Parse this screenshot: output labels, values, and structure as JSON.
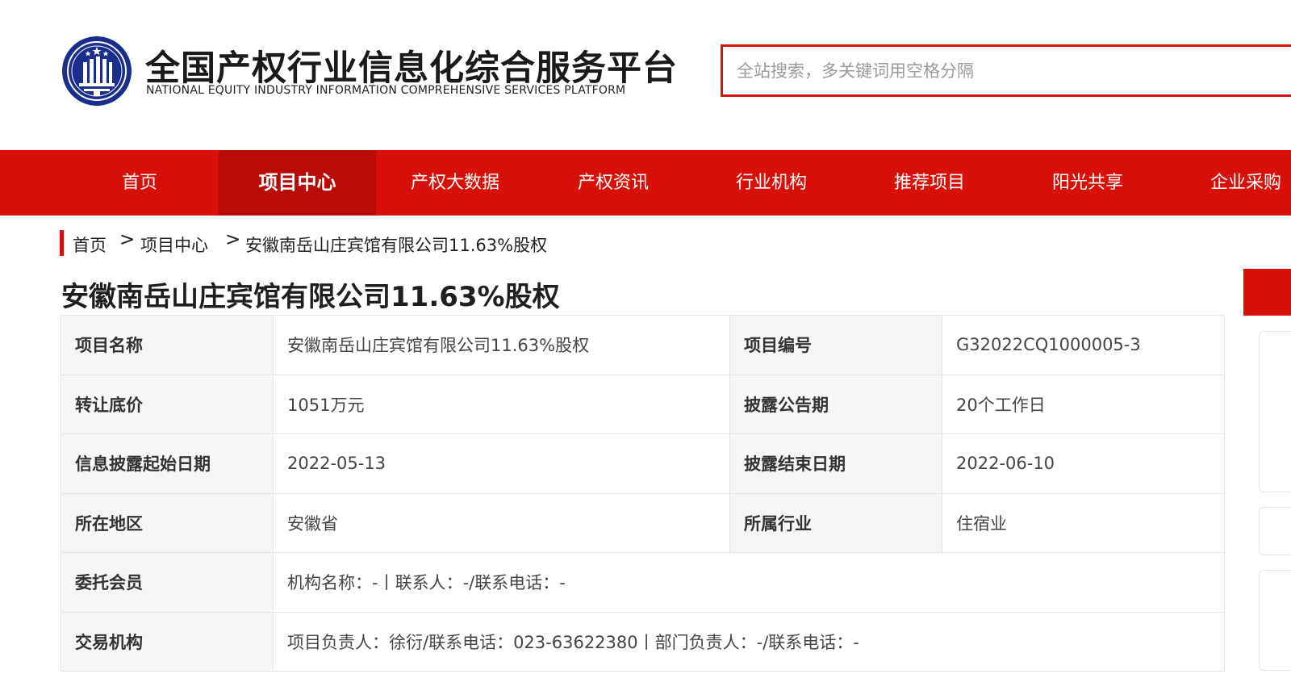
{
  "header": {
    "title_cn": "全国产权行业信息化综合服务平台",
    "title_en": "NATIONAL EQUITY INDUSTRY INFORMATION COMPREHENSIVE SERVICES PLATFORM",
    "logo_icon": "national-emblem-logo-icon",
    "search_placeholder": "全站搜索，多关键词用空格分隔"
  },
  "nav": {
    "items": [
      {
        "label": "首页"
      },
      {
        "label": "项目中心",
        "active": true
      },
      {
        "label": "产权大数据"
      },
      {
        "label": "产权资讯"
      },
      {
        "label": "行业机构"
      },
      {
        "label": "推荐项目"
      },
      {
        "label": "阳光共享"
      },
      {
        "label": "企业采购"
      }
    ]
  },
  "breadcrumb": {
    "items": [
      "首页",
      "项目中心",
      "安徽南岳山庄宾馆有限公司11.63%股权"
    ],
    "separator": ">"
  },
  "page_title": "安徽南岳山庄宾馆有限公司11.63%股权",
  "details": {
    "rows": [
      {
        "label1": "项目名称",
        "value1": "安徽南岳山庄宾馆有限公司11.63%股权",
        "label2": "项目编号",
        "value2": "G32022CQ1000005-3"
      },
      {
        "label1": "转让底价",
        "value1": "1051万元",
        "label2": "披露公告期",
        "value2": "20个工作日"
      },
      {
        "label1": "信息披露起始日期",
        "value1": "2022-05-13",
        "label2": "披露结束日期",
        "value2": "2022-06-10"
      },
      {
        "label1": "所在地区",
        "value1": "安徽省",
        "label2": "所属行业",
        "value2": "住宿业"
      }
    ],
    "wide_rows": [
      {
        "label": "委托会员",
        "value": "机构名称：-丨联系人：-/联系电话：-"
      },
      {
        "label": "交易机构",
        "value": "项目负责人：徐衍/联系电话：023-63622380丨部门负责人：-/联系电话：-"
      }
    ]
  },
  "colors": {
    "brand_red": "#d7100a",
    "nav_active": "#b80b06",
    "logo_blue": "#1c2e8c"
  }
}
